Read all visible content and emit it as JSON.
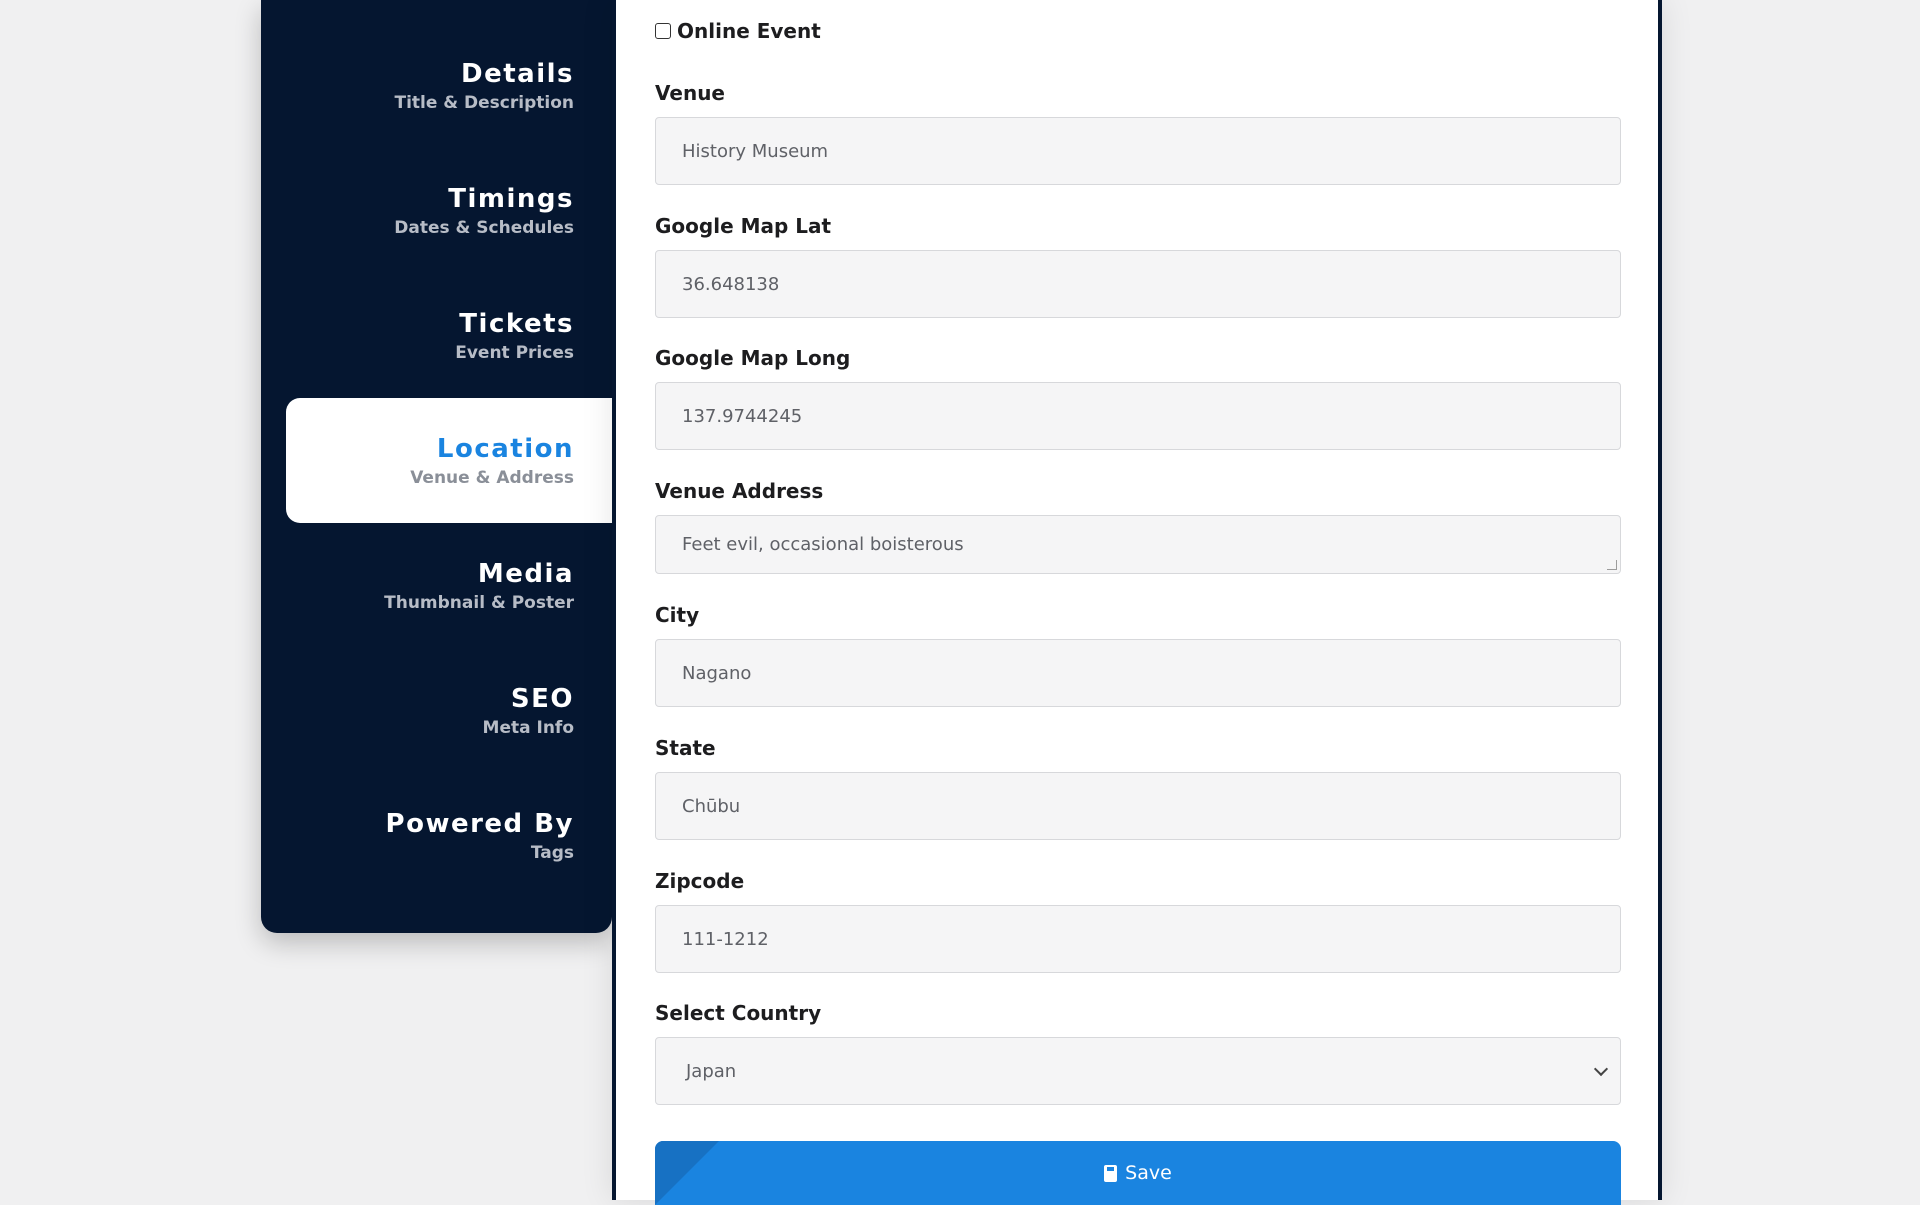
{
  "sidebar": {
    "items": [
      {
        "title": "Details",
        "subtitle": "Title & Description"
      },
      {
        "title": "Timings",
        "subtitle": "Dates & Schedules"
      },
      {
        "title": "Tickets",
        "subtitle": "Event Prices"
      },
      {
        "title": "Location",
        "subtitle": "Venue & Address"
      },
      {
        "title": "Media",
        "subtitle": "Thumbnail & Poster"
      },
      {
        "title": "SEO",
        "subtitle": "Meta Info"
      },
      {
        "title": "Powered By",
        "subtitle": "Tags"
      }
    ],
    "active_index": 3
  },
  "form": {
    "online_event": {
      "label": "Online Event",
      "checked": false
    },
    "venue": {
      "label": "Venue",
      "value": "History Museum"
    },
    "lat": {
      "label": "Google Map Lat",
      "value": "36.648138"
    },
    "long": {
      "label": "Google Map Long",
      "value": "137.9744245"
    },
    "address": {
      "label": "Venue Address",
      "value": "Feet evil, occasional boisterous"
    },
    "city": {
      "label": "City",
      "value": "Nagano"
    },
    "state": {
      "label": "State",
      "value": "Chūbu"
    },
    "zipcode": {
      "label": "Zipcode",
      "value": "111-1212"
    },
    "country": {
      "label": "Select Country",
      "value": "Japan"
    },
    "save_label": "Save"
  },
  "colors": {
    "sidebar_bg": "#051630",
    "accent": "#1a84e0",
    "input_bg": "#f5f5f6"
  }
}
